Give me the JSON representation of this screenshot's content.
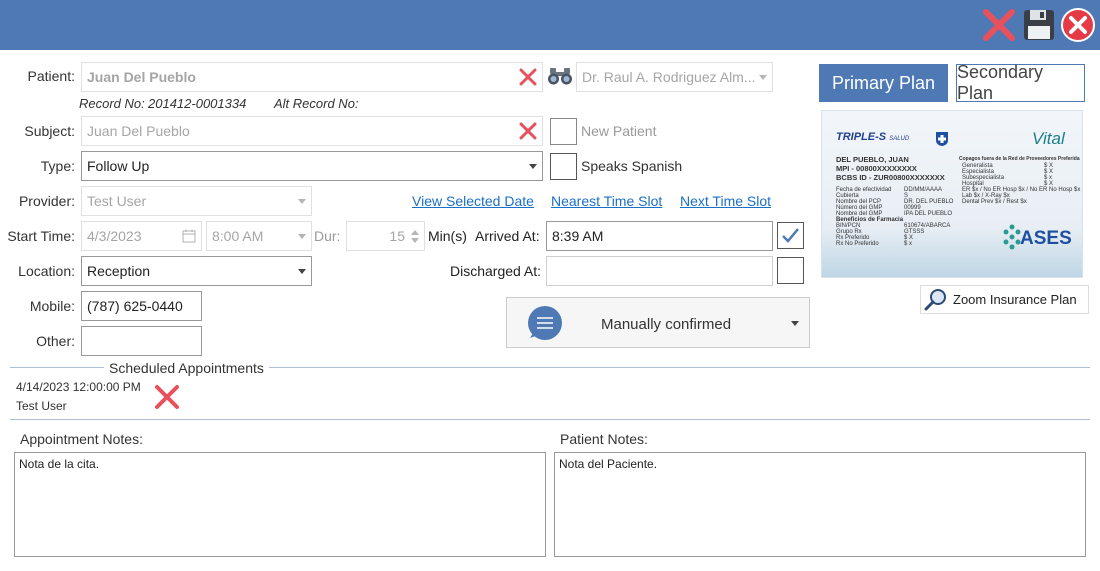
{
  "patient": {
    "label": "Patient:",
    "name": "Juan Del Pueblo",
    "doctor": "Dr. Raul A. Rodriguez Alm...",
    "record_label": "Record No:",
    "record_no": "201412-0001334",
    "alt_record_label": "Alt Record No:"
  },
  "subject": {
    "label": "Subject:",
    "value": "Juan Del Pueblo",
    "new_patient_label": "New Patient"
  },
  "type": {
    "label": "Type:",
    "value": "Follow Up",
    "speaks_spanish_label": "Speaks Spanish"
  },
  "provider": {
    "label": "Provider:",
    "value": "Test User"
  },
  "links": {
    "view_selected_date": "View Selected Date",
    "nearest_time_slot": "Nearest Time Slot",
    "next_time_slot": "Next Time Slot"
  },
  "start_time": {
    "label": "Start Time:",
    "date": "4/3/2023",
    "time": "8:00 AM",
    "dur_label": "Dur:",
    "dur_value": "15",
    "min_label": "Min(s)",
    "arrived_label": "Arrived At:",
    "arrived_value": "8:39 AM"
  },
  "location": {
    "label": "Location:",
    "value": "Reception",
    "discharged_label": "Discharged At:"
  },
  "mobile": {
    "label": "Mobile:",
    "value": "(787) 625-0440"
  },
  "other": {
    "label": "Other:"
  },
  "confirmation": {
    "status": "Manually confirmed"
  },
  "plans": {
    "primary": "Primary Plan",
    "secondary": "Secondary Plan",
    "zoom": "Zoom Insurance Plan"
  },
  "card": {
    "brand": "TRIPLE-S",
    "brand_sub": "SALUD",
    "vital": "Vital",
    "name": "DEL PUEBLO, JUAN",
    "mpi": "MPI - 00800XXXXXXXX",
    "bcbs": "BCBS ID - ZUR00800XXXXXXX",
    "ases": "ASES",
    "left_rows": [
      [
        "Fecha de efectividad",
        "DD/MM/AAAA"
      ],
      [
        "Cubierta",
        "S"
      ],
      [
        "Nombre del PCP",
        "DR. DEL PUEBLO"
      ],
      [
        "Número del GMP",
        "00999"
      ],
      [
        "Nombre del GMP",
        "IPA DEL PUEBLO"
      ],
      [
        "Beneficios de Farmacia",
        ""
      ],
      [
        "BIN/PCN",
        "610674/ABARCA"
      ],
      [
        "Grupo Rx",
        "GTSSS"
      ],
      [
        "Rx Preferido",
        "$ X"
      ],
      [
        "Rx No Preferido",
        "$ x"
      ]
    ],
    "right_title": "Copagos fuera de la Red de Proveedores Preferida",
    "right_rows": [
      [
        "Generalista",
        "$ X"
      ],
      [
        "Especialista",
        "$ X"
      ],
      [
        "Subespecialista",
        "$ x"
      ],
      [
        "Hospital",
        "$ X"
      ],
      [
        "ER $x / No ER Hosp $x / No ER No Hosp $x",
        ""
      ],
      [
        "Lab $x / X-Ray $x",
        ""
      ],
      [
        "Dental Prev $x / Rest $x",
        ""
      ]
    ]
  },
  "scheduled": {
    "title": "Scheduled Appointments",
    "items": [
      {
        "datetime": "4/14/2023 12:00:00 PM",
        "provider": "Test User"
      }
    ]
  },
  "notes": {
    "appointment_label": "Appointment Notes:",
    "appointment_value": "Nota de la cita.",
    "patient_label": "Patient Notes:",
    "patient_value": "Nota del Paciente."
  },
  "colors": {
    "titlebar": "#4e79b4",
    "link": "#1a6fc7",
    "delete_red": "#e8505b",
    "accent_blue": "#4e79b4"
  },
  "icons": [
    "close-x-icon",
    "save-disk-icon",
    "close-circle-icon",
    "binoculars-icon",
    "calendar-icon",
    "checkmark-icon",
    "chat-bubble-icon",
    "magnifier-icon"
  ]
}
